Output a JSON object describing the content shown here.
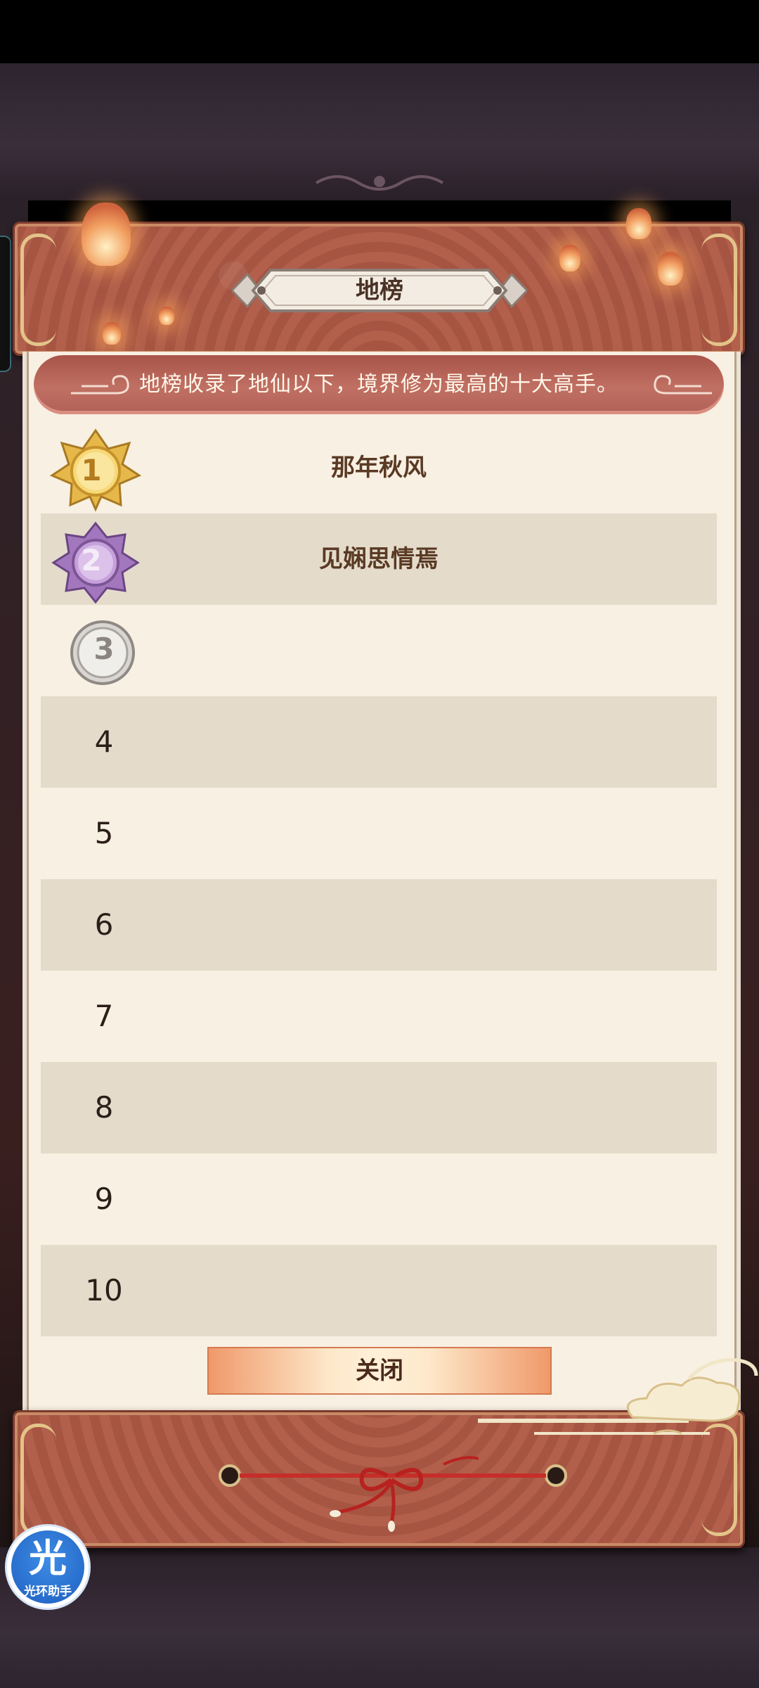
{
  "title": "地榜",
  "intro": "地榜收录了地仙以下，境界修为最高的十大高手。",
  "ranks": [
    {
      "rank": "1",
      "name": "那年秋风",
      "medal": "gold"
    },
    {
      "rank": "2",
      "name": "见娴思情焉",
      "medal": "purple"
    },
    {
      "rank": "3",
      "name": "",
      "medal": "silver"
    },
    {
      "rank": "4",
      "name": ""
    },
    {
      "rank": "5",
      "name": ""
    },
    {
      "rank": "6",
      "name": ""
    },
    {
      "rank": "7",
      "name": ""
    },
    {
      "rank": "8",
      "name": ""
    },
    {
      "rank": "9",
      "name": ""
    },
    {
      "rank": "10",
      "name": ""
    }
  ],
  "close_label": "关闭",
  "helper": {
    "glyph": "光",
    "label": "光环助手"
  },
  "colors": {
    "frame": "#b2604c",
    "paper": "#f8f0e2",
    "row_shade": "#e4dbcb",
    "name_text": "#5a3a24"
  }
}
